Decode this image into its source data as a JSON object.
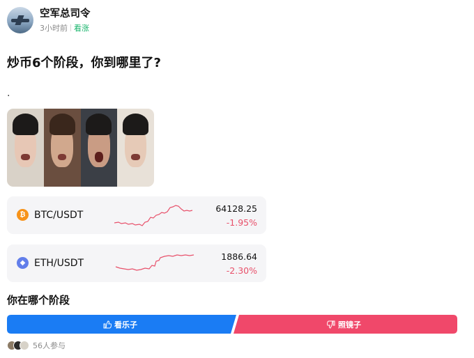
{
  "post": {
    "author": "空军总司令",
    "time": "3小时前",
    "tag": "看涨",
    "title": "炒币6个阶段，你到哪里了?",
    "body_text": "."
  },
  "tickers": [
    {
      "symbol": "BTC/USDT",
      "price": "64128.25",
      "change": "-1.95%",
      "icon": "bitcoin-icon",
      "icon_glyph": "₿",
      "icon_color": "#f7931a"
    },
    {
      "symbol": "ETH/USDT",
      "price": "1886.64",
      "change": "-2.30%",
      "icon": "ethereum-icon",
      "icon_glyph": "◆",
      "icon_color": "#627eea"
    }
  ],
  "poll": {
    "question": "你在哪个阶段",
    "option_up": "看乐子",
    "option_down": "照镜子",
    "participants": "56人参与",
    "colors": {
      "up": "#1a7cf4",
      "down": "#f0486a"
    }
  },
  "colors": {
    "bullish_tag": "#18b46b",
    "negative_change": "#e8506a",
    "sparkline": "#e8506a"
  }
}
